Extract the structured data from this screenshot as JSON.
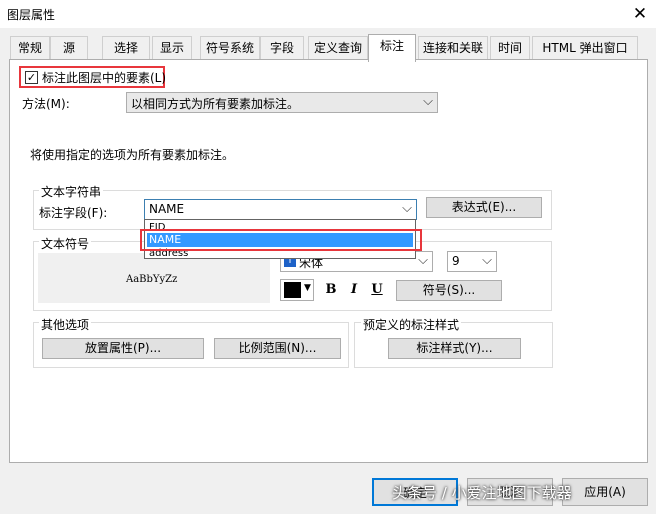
{
  "window": {
    "title": "图层属性",
    "close_glyph": "✕"
  },
  "tabs": [
    {
      "label": "常规"
    },
    {
      "label": "源"
    },
    {
      "label": "选择"
    },
    {
      "label": "显示"
    },
    {
      "label": "符号系统"
    },
    {
      "label": "字段"
    },
    {
      "label": "定义查询"
    },
    {
      "label": "标注",
      "active": true
    },
    {
      "label": "连接和关联"
    },
    {
      "label": "时间"
    },
    {
      "label": "HTML 弹出窗口"
    }
  ],
  "label_toggle": {
    "label": "标注此图层中的要素(L)",
    "checked": true,
    "check_glyph": "✓"
  },
  "method": {
    "label": "方法(M):",
    "value": "以相同方式为所有要素加标注。"
  },
  "description": "将使用指定的选项为所有要素加标注。",
  "text_string": {
    "group_title": "文本字符串",
    "field_label": "标注字段(F):",
    "field_value": "NAME",
    "expression_button": "表达式(E)...",
    "dropdown_options": [
      "FID",
      "NAME",
      "address"
    ],
    "selected_option": "NAME"
  },
  "text_symbol": {
    "group_title": "文本符号",
    "preview_text": "AaBbYyZz",
    "font_value": "宋体",
    "size_value": "9",
    "bold": "B",
    "italic": "I",
    "underline": "U",
    "symbol_button": "符号(S)..."
  },
  "other_options": {
    "group_title": "其他选项",
    "placement_button": "放置属性(P)...",
    "scale_button": "比例范围(N)..."
  },
  "predefined": {
    "group_title": "预定义的标注样式",
    "style_button": "标注样式(Y)..."
  },
  "footer": {
    "ok": "确定",
    "cancel": "取消",
    "apply": "应用(A)"
  },
  "watermark": "头条号 / 小爱注地图下载器",
  "icons": {
    "dropdown_arrow": "⌵",
    "font_type": "T"
  },
  "colors": {
    "highlight": "#e8363c",
    "selection": "#3399ff",
    "accent": "#0078d7"
  }
}
